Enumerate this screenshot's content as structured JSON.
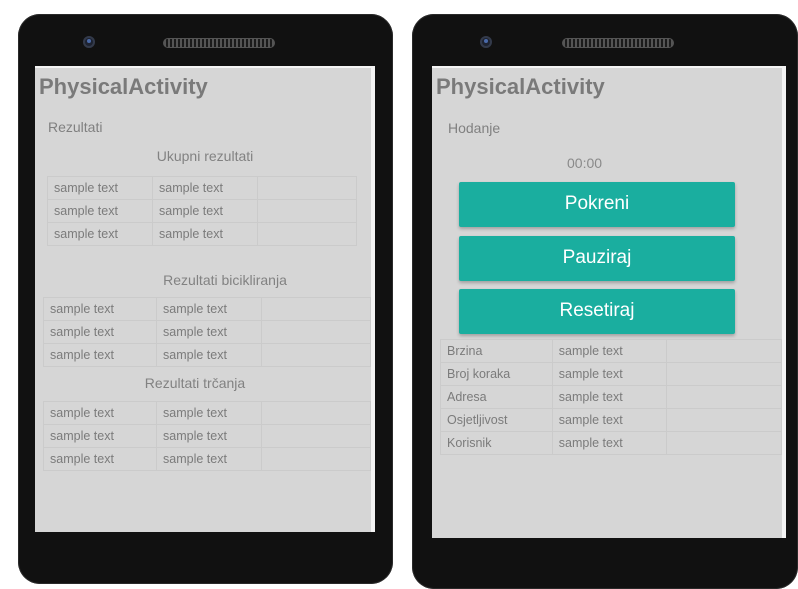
{
  "app": {
    "title": "PhysicalActivity"
  },
  "left": {
    "heading": "Rezultati",
    "total": {
      "title": "Ukupni rezultati",
      "rows": [
        [
          "sample text",
          "sample text",
          ""
        ],
        [
          "sample text",
          "sample text",
          ""
        ],
        [
          "sample text",
          "sample text",
          ""
        ]
      ]
    },
    "cycling": {
      "title": "Rezultati bicikliranja",
      "rows": [
        [
          "sample text",
          "sample text",
          ""
        ],
        [
          "sample text",
          "sample text",
          ""
        ],
        [
          "sample text",
          "sample text",
          ""
        ]
      ]
    },
    "running": {
      "title": "Rezultati trčanja",
      "rows": [
        [
          "sample text",
          "sample text",
          ""
        ],
        [
          "sample text",
          "sample text",
          ""
        ],
        [
          "sample text",
          "sample text",
          ""
        ]
      ]
    }
  },
  "right": {
    "heading": "Hodanje",
    "timer": "00:00",
    "buttons": {
      "start": "Pokreni",
      "pause": "Pauziraj",
      "reset": "Resetiraj"
    },
    "details": [
      {
        "label": "Brzina",
        "value": "sample text"
      },
      {
        "label": "Broj koraka",
        "value": "sample text"
      },
      {
        "label": "Adresa",
        "value": "sample text"
      },
      {
        "label": "Osjetljivost",
        "value": "sample text"
      },
      {
        "label": "Korisnik",
        "value": "sample text"
      }
    ]
  }
}
